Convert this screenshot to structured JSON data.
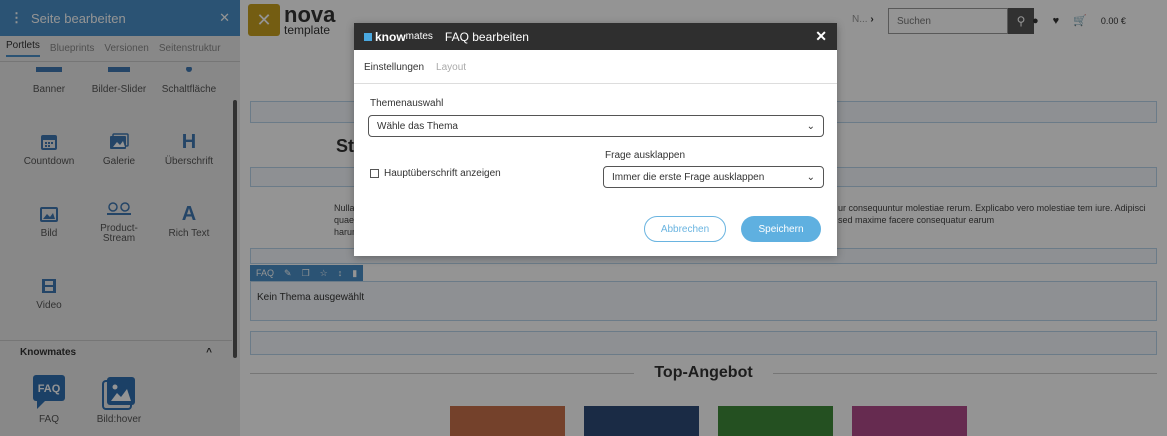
{
  "sidebar": {
    "title": "Seite bearbeiten",
    "tabs": [
      "Portlets",
      "Blueprints",
      "Versionen",
      "Seitenstruktur"
    ],
    "portlets": [
      {
        "label": "Banner",
        "icon": "banner-icon"
      },
      {
        "label": "Bilder-Slider",
        "icon": "image-slider-icon"
      },
      {
        "label": "Schaltfläche",
        "icon": "button-icon"
      },
      {
        "label": "Countdown",
        "icon": "calendar-icon"
      },
      {
        "label": "Galerie",
        "icon": "gallery-icon"
      },
      {
        "label": "Überschrift",
        "icon": "heading-icon",
        "glyph": "H"
      },
      {
        "label": "Bild",
        "icon": "image-icon"
      },
      {
        "label": "Product-\nStream",
        "icon": "product-stream-icon"
      },
      {
        "label": "Rich Text",
        "icon": "rich-text-icon",
        "glyph": "A"
      },
      {
        "label": "Video",
        "icon": "video-icon"
      }
    ],
    "knowmates_section": "Knowmates",
    "knowmates_portlets": [
      {
        "label": "FAQ",
        "icon": "faq-icon",
        "glyph": "FAQ"
      },
      {
        "label": "Bild:hover",
        "icon": "image-hover-icon"
      }
    ]
  },
  "header": {
    "logo_name": "nova",
    "logo_sub": "template",
    "nav_more": "N...",
    "search_placeholder": "Suchen",
    "cart_total": "0.00 €"
  },
  "page": {
    "title_partial": "St",
    "lorem_left": "Nulla quae harum",
    "lorem_right": "ur consequuntur molestiae rerum. Explicabo vero molestiae tem iure. Adipisci sed maxime facere consequatur earum",
    "faq_label": "FAQ",
    "faq_empty": "Kein Thema ausgewählt",
    "top_angebot": "Top-Angebot",
    "tile_colors": [
      "#c9704a",
      "#2e4a78",
      "#3e8a3a",
      "#b04a8a"
    ]
  },
  "modal": {
    "brand_bold": "know",
    "brand_light": "mates",
    "title": "FAQ bearbeiten",
    "tabs": [
      "Einstellungen",
      "Layout"
    ],
    "theme_label": "Themenauswahl",
    "theme_value": "Wähle das Thema",
    "checkbox_label": "Hauptüberschrift anzeigen",
    "expand_label": "Frage ausklappen",
    "expand_value": "Immer die erste Frage ausklappen",
    "cancel": "Abbrechen",
    "save": "Speichern"
  }
}
